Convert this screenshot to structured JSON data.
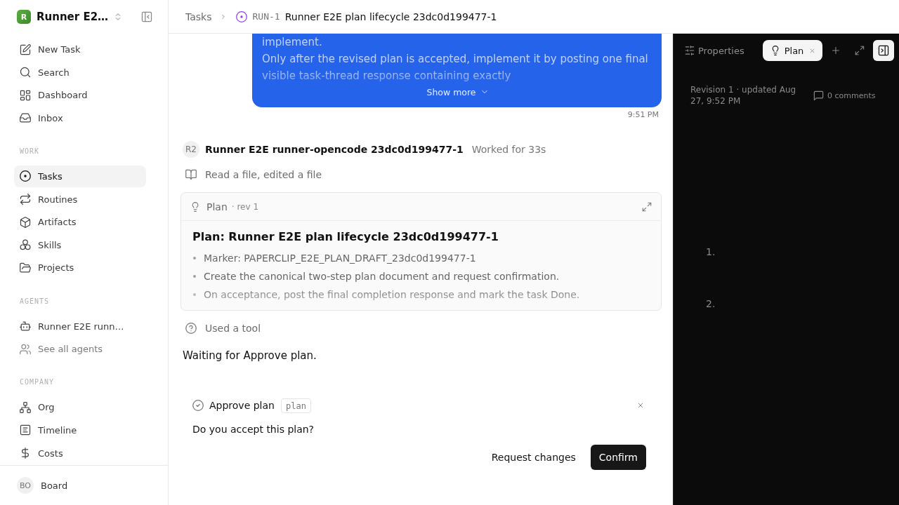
{
  "sidebar": {
    "workspace": {
      "logo": "R",
      "name": "Runner E2…"
    },
    "top_items": [
      {
        "label": "New Task",
        "selected": false
      },
      {
        "label": "Search",
        "selected": false
      },
      {
        "label": "Dashboard",
        "selected": false
      },
      {
        "label": "Inbox",
        "selected": false
      }
    ],
    "sections": [
      {
        "title": "WORK",
        "items": [
          {
            "label": "Tasks",
            "selected": true
          },
          {
            "label": "Routines",
            "selected": false
          },
          {
            "label": "Artifacts",
            "selected": false
          },
          {
            "label": "Skills",
            "selected": false
          },
          {
            "label": "Projects",
            "selected": false
          }
        ]
      },
      {
        "title": "AGENTS",
        "items": [
          {
            "label": "Runner E2E runn…",
            "kind": "agent",
            "selected": false
          },
          {
            "label": "See all agents",
            "kind": "link",
            "selected": false
          }
        ]
      },
      {
        "title": "COMPANY",
        "items": [
          {
            "label": "Org",
            "selected": false
          },
          {
            "label": "Timeline",
            "selected": false
          },
          {
            "label": "Costs",
            "selected": false
          }
        ]
      }
    ],
    "user": {
      "initials": "BO",
      "name": "Board"
    }
  },
  "breadcrumb": {
    "parent": "Tasks",
    "id": "RUN-1",
    "title": "Runner E2E plan lifecycle 23dc0d199477-1"
  },
  "thread": {
    "user_message": {
      "paragraphs": [
        "implement.",
        "Only after the revised plan is accepted, implement it by posting one final visible task-thread response containing exactly"
      ],
      "show_more": "Show more",
      "time": "9:51 PM"
    },
    "agent_reply": {
      "avatar": "R2",
      "name": "Runner E2E runner-opencode 23dc0d199477-1",
      "duration": "Worked for 33s",
      "activity": "Read a file, edited a file",
      "plan_card": {
        "label": "Plan",
        "revision": "· rev 1",
        "title": "Plan: Runner E2E plan lifecycle 23dc0d199477-1",
        "bullets": [
          "Marker: PAPERCLIP_E2E_PLAN_DRAFT_23dc0d199477-1",
          "Create the canonical two-step plan document and request confirmation.",
          "On acceptance, post the final completion response and mark the task Done."
        ]
      },
      "tool_use": "Used a tool",
      "text": "Waiting for Approve plan."
    },
    "approval": {
      "title": "Approve plan",
      "tag": "plan",
      "question": "Do you accept this plan?",
      "buttons": [
        {
          "label": "Request changes",
          "kind": "secondary"
        },
        {
          "label": "Confirm",
          "kind": "primary"
        }
      ]
    }
  },
  "panel": {
    "tabs": [
      {
        "label": "Properties",
        "selected": false,
        "closable": false
      },
      {
        "label": "Plan",
        "selected": true,
        "closable": true
      }
    ],
    "meta": "Revision 1 · updated Aug 27, 9:52 PM",
    "comments": "0 comments",
    "list_markers": [
      "1.",
      "2."
    ]
  }
}
